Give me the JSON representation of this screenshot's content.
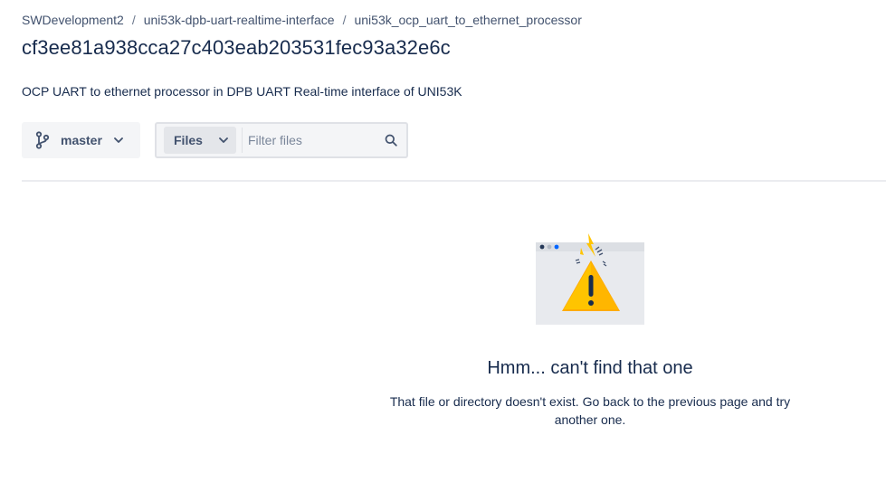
{
  "breadcrumb": {
    "items": [
      {
        "label": "SWDevelopment2"
      },
      {
        "label": "uni53k-dpb-uart-realtime-interface"
      },
      {
        "label": "uni53k_ocp_uart_to_ethernet_processor"
      }
    ],
    "separator": "/"
  },
  "page": {
    "title": "cf3ee81a938cca27c403eab203531fec93a32e6c",
    "description": "OCP UART to ethernet processor in DPB UART Real-time interface of UNI53K"
  },
  "toolbar": {
    "branch": {
      "label": "master",
      "icon": "branch-icon"
    },
    "filter": {
      "type_label": "Files",
      "placeholder": "Filter files",
      "value": "",
      "search_icon": "search-icon"
    }
  },
  "empty_state": {
    "title": "Hmm... can't find that one",
    "message": "That file or directory doesn't exist. Go back to the previous page and try another one.",
    "illustration": "warning-browser-illustration"
  },
  "colors": {
    "text_primary": "#172b4d",
    "text_secondary": "#42526e",
    "warning": "#ffc400",
    "link_blue": "#0065ff"
  }
}
